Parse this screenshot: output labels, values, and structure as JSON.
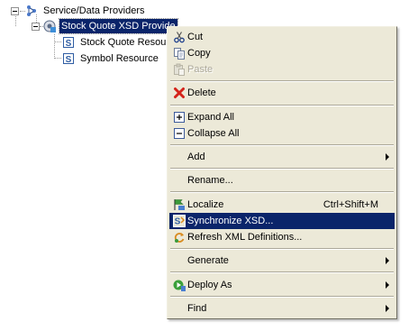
{
  "tree": {
    "items": [
      {
        "label": "Service/Data Providers"
      },
      {
        "label": "Stock Quote XSD Provide"
      },
      {
        "label": "Stock Quote Resourc"
      },
      {
        "label": "Symbol Resource"
      }
    ]
  },
  "menu": {
    "items": [
      {
        "label": "Cut"
      },
      {
        "label": "Copy"
      },
      {
        "label": "Paste",
        "disabled": true
      },
      {
        "label": "Delete"
      },
      {
        "label": "Expand All"
      },
      {
        "label": "Collapse All"
      },
      {
        "label": "Add",
        "submenu": true
      },
      {
        "label": "Rename..."
      },
      {
        "label": "Localize",
        "shortcut": "Ctrl+Shift+M"
      },
      {
        "label": "Synchronize XSD...",
        "highlighted": true
      },
      {
        "label": "Refresh XML Definitions..."
      },
      {
        "label": "Generate",
        "submenu": true
      },
      {
        "label": "Deploy As",
        "submenu": true
      },
      {
        "label": "Find",
        "submenu": true
      }
    ]
  },
  "icons": {
    "cut": "scissors-icon",
    "copy": "copy-icon",
    "paste": "paste-icon",
    "delete": "red-x-icon",
    "expand": "plus-box-icon",
    "collapse": "minus-box-icon",
    "localize": "localize-flag-icon",
    "sync": "sync-xsd-icon",
    "refresh": "refresh-icon",
    "deploy": "deploy-icon"
  },
  "colors": {
    "menu_bg": "#ece9d8",
    "selection": "#0a246a",
    "disabled_text": "#aca899"
  }
}
